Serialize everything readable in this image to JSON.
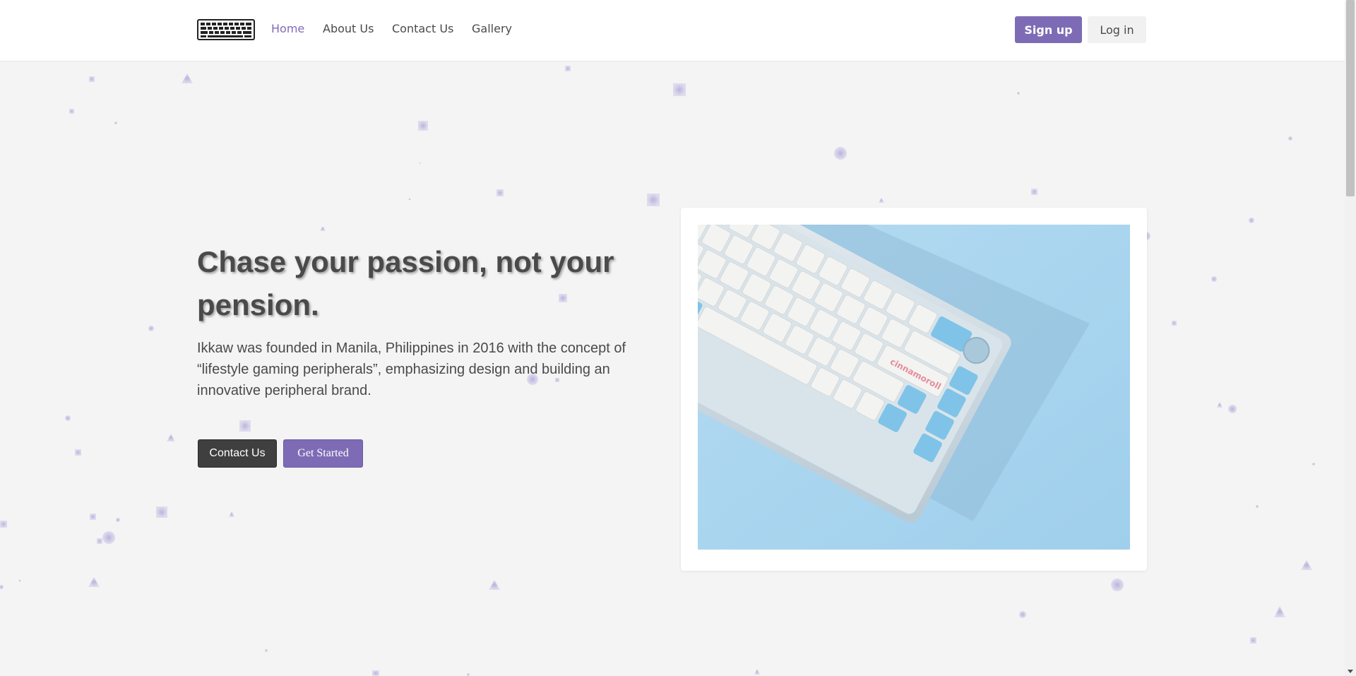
{
  "nav": {
    "logo_icon": "keyboard-icon",
    "links": [
      {
        "label": "Home",
        "active": true
      },
      {
        "label": "About Us",
        "active": false
      },
      {
        "label": "Contact Us",
        "active": false
      },
      {
        "label": "Gallery",
        "active": false
      }
    ],
    "signup_label": "Sign up",
    "login_label": "Log in"
  },
  "hero": {
    "title": "Chase your passion, not your pension.",
    "description": "Ikkaw was founded in Manila, Philippines in 2016 with the concept of “lifestyle gaming peripherals”, emphasizing design and building an innovative peripheral brand.",
    "contact_button": "Contact Us",
    "started_button": "Get Started",
    "image_icon": "keyboard-photo"
  },
  "colors": {
    "accent": "#7d6cb5",
    "dark_button": "#3f3f3f",
    "background": "#f4f4f4",
    "text": "#4a4a4a",
    "photo_bg": "#a9d4ee",
    "particle": "#b9b2dc"
  }
}
